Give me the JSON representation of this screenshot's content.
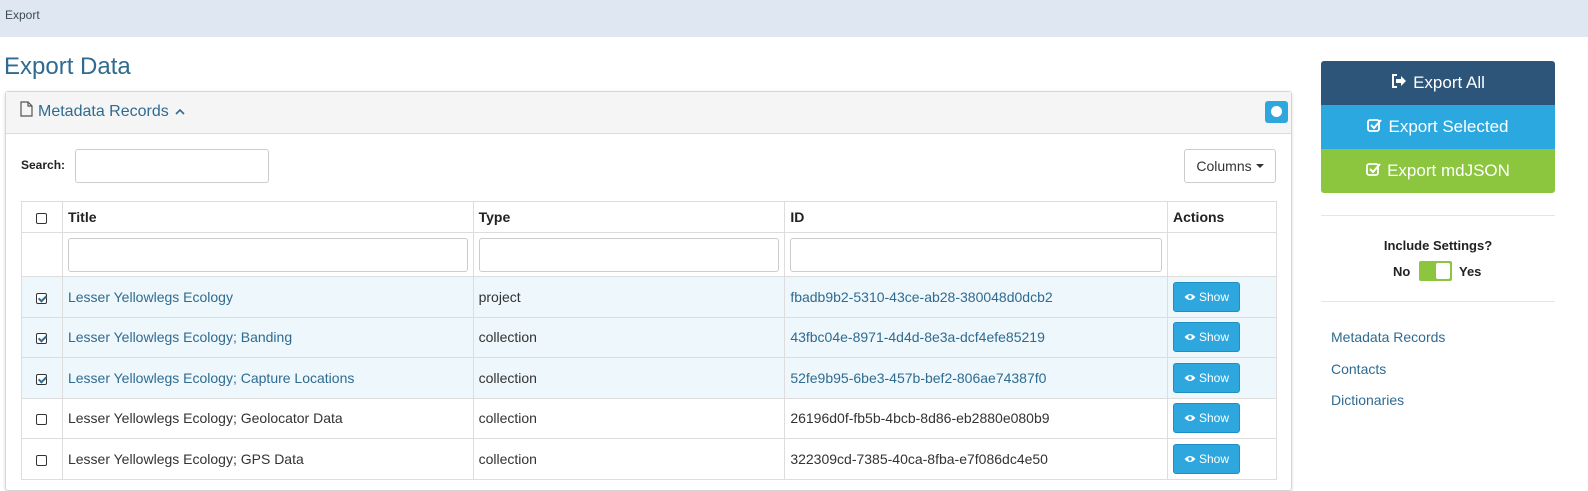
{
  "breadcrumb": "Export",
  "page_title": "Export Data",
  "panel": {
    "title": "Metadata Records",
    "search_label": "Search:",
    "columns_label": "Columns"
  },
  "table": {
    "headers": [
      "Title",
      "Type",
      "ID",
      "Actions"
    ],
    "rows": [
      {
        "checked": true,
        "title": "Lesser Yellowlegs Ecology",
        "type": "project",
        "id": "fbadb9b2-5310-43ce-ab28-380048d0dcb2",
        "action": "Show"
      },
      {
        "checked": true,
        "title": "Lesser Yellowlegs Ecology; Banding",
        "type": "collection",
        "id": "43fbc04e-8971-4d4d-8e3a-dcf4efe85219",
        "action": "Show"
      },
      {
        "checked": true,
        "title": "Lesser Yellowlegs Ecology; Capture Locations",
        "type": "collection",
        "id": "52fe9b95-6be3-457b-bef2-806ae74387f0",
        "action": "Show"
      },
      {
        "checked": false,
        "title": "Lesser Yellowlegs Ecology; Geolocator Data",
        "type": "collection",
        "id": "26196d0f-fb5b-4bcb-8d86-eb2880e080b9",
        "action": "Show"
      },
      {
        "checked": false,
        "title": "Lesser Yellowlegs Ecology; GPS Data",
        "type": "collection",
        "id": "322309cd-7385-40ca-8fba-e7f086dc4e50",
        "action": "Show"
      }
    ]
  },
  "sidebar": {
    "export_all": "Export All",
    "export_selected": "Export Selected",
    "export_mdjson": "Export mdJSON",
    "include_settings": "Include Settings?",
    "no": "No",
    "yes": "Yes",
    "include_settings_value": true,
    "links": [
      "Metadata Records",
      "Contacts",
      "Dictionaries"
    ]
  },
  "colors": {
    "export_all": "#2d5479",
    "export_selected": "#2ca8e0",
    "export_mdjson": "#8cc63f",
    "link": "#2f6b91"
  }
}
